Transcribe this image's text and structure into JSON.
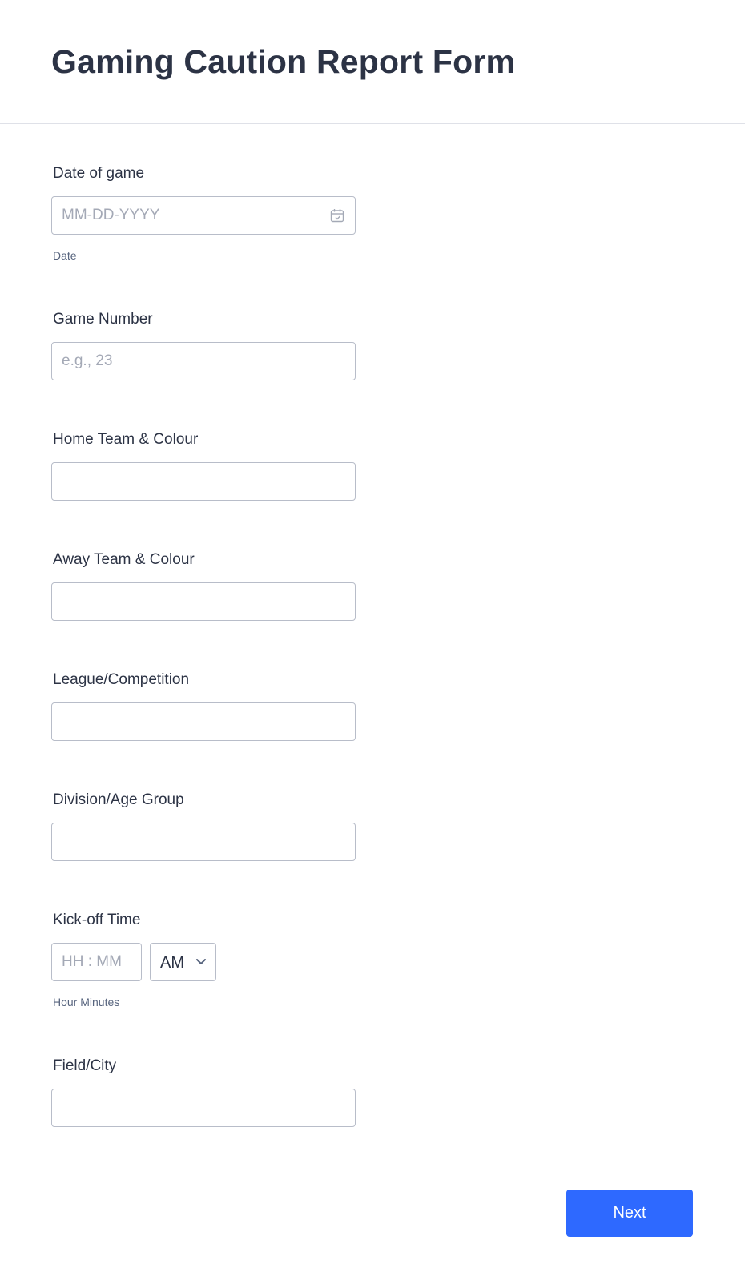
{
  "form": {
    "title": "Gaming Caution Report Form"
  },
  "fields": {
    "date_of_game": {
      "label": "Date of game",
      "placeholder": "MM-DD-YYYY",
      "sublabel": "Date"
    },
    "game_number": {
      "label": "Game Number",
      "placeholder": "e.g., 23"
    },
    "home_team": {
      "label": "Home Team & Colour",
      "value": ""
    },
    "away_team": {
      "label": "Away Team & Colour",
      "value": ""
    },
    "league": {
      "label": "League/Competition",
      "value": ""
    },
    "division": {
      "label": "Division/Age Group",
      "value": ""
    },
    "kickoff_time": {
      "label": "Kick-off Time",
      "placeholder": "HH : MM",
      "ampm_selected": "AM",
      "sublabel": "Hour Minutes"
    },
    "field_city": {
      "label": "Field/City",
      "value": ""
    }
  },
  "footer": {
    "next_label": "Next"
  },
  "colors": {
    "accent": "#2e69ff",
    "text": "#2c3345",
    "border": "#b8bdc9",
    "placeholder": "#a4a9b6"
  },
  "icons": {
    "date_icon": "calendar-icon",
    "ampm_icon": "chevron-down-icon"
  }
}
